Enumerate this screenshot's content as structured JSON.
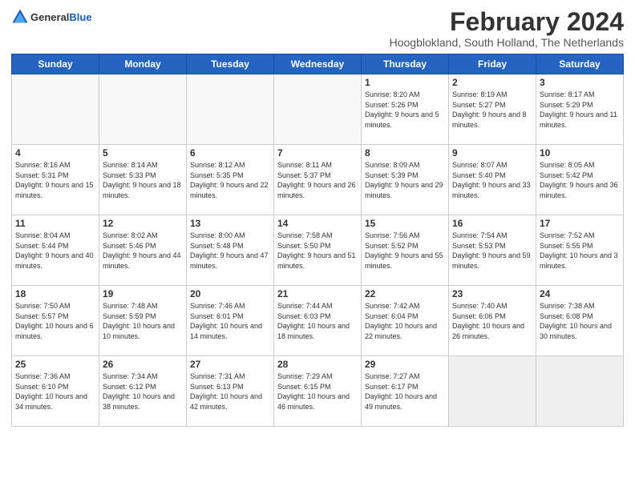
{
  "header": {
    "logo": {
      "general": "General",
      "blue": "Blue"
    },
    "title": "February 2024",
    "subtitle": "Hoogblokland, South Holland, The Netherlands"
  },
  "calendar": {
    "headers": [
      "Sunday",
      "Monday",
      "Tuesday",
      "Wednesday",
      "Thursday",
      "Friday",
      "Saturday"
    ],
    "weeks": [
      [
        {
          "day": "",
          "empty": true
        },
        {
          "day": "",
          "empty": true
        },
        {
          "day": "",
          "empty": true
        },
        {
          "day": "",
          "empty": true
        },
        {
          "day": "1",
          "info": "Sunrise: 8:20 AM\nSunset: 5:26 PM\nDaylight: 9 hours\nand 5 minutes."
        },
        {
          "day": "2",
          "info": "Sunrise: 8:19 AM\nSunset: 5:27 PM\nDaylight: 9 hours\nand 8 minutes."
        },
        {
          "day": "3",
          "info": "Sunrise: 8:17 AM\nSunset: 5:29 PM\nDaylight: 9 hours\nand 11 minutes."
        }
      ],
      [
        {
          "day": "4",
          "info": "Sunrise: 8:16 AM\nSunset: 5:31 PM\nDaylight: 9 hours\nand 15 minutes."
        },
        {
          "day": "5",
          "info": "Sunrise: 8:14 AM\nSunset: 5:33 PM\nDaylight: 9 hours\nand 18 minutes."
        },
        {
          "day": "6",
          "info": "Sunrise: 8:12 AM\nSunset: 5:35 PM\nDaylight: 9 hours\nand 22 minutes."
        },
        {
          "day": "7",
          "info": "Sunrise: 8:11 AM\nSunset: 5:37 PM\nDaylight: 9 hours\nand 26 minutes."
        },
        {
          "day": "8",
          "info": "Sunrise: 8:09 AM\nSunset: 5:39 PM\nDaylight: 9 hours\nand 29 minutes."
        },
        {
          "day": "9",
          "info": "Sunrise: 8:07 AM\nSunset: 5:40 PM\nDaylight: 9 hours\nand 33 minutes."
        },
        {
          "day": "10",
          "info": "Sunrise: 8:05 AM\nSunset: 5:42 PM\nDaylight: 9 hours\nand 36 minutes."
        }
      ],
      [
        {
          "day": "11",
          "info": "Sunrise: 8:04 AM\nSunset: 5:44 PM\nDaylight: 9 hours\nand 40 minutes."
        },
        {
          "day": "12",
          "info": "Sunrise: 8:02 AM\nSunset: 5:46 PM\nDaylight: 9 hours\nand 44 minutes."
        },
        {
          "day": "13",
          "info": "Sunrise: 8:00 AM\nSunset: 5:48 PM\nDaylight: 9 hours\nand 47 minutes."
        },
        {
          "day": "14",
          "info": "Sunrise: 7:58 AM\nSunset: 5:50 PM\nDaylight: 9 hours\nand 51 minutes."
        },
        {
          "day": "15",
          "info": "Sunrise: 7:56 AM\nSunset: 5:52 PM\nDaylight: 9 hours\nand 55 minutes."
        },
        {
          "day": "16",
          "info": "Sunrise: 7:54 AM\nSunset: 5:53 PM\nDaylight: 9 hours\nand 59 minutes."
        },
        {
          "day": "17",
          "info": "Sunrise: 7:52 AM\nSunset: 5:55 PM\nDaylight: 10 hours\nand 3 minutes."
        }
      ],
      [
        {
          "day": "18",
          "info": "Sunrise: 7:50 AM\nSunset: 5:57 PM\nDaylight: 10 hours\nand 6 minutes."
        },
        {
          "day": "19",
          "info": "Sunrise: 7:48 AM\nSunset: 5:59 PM\nDaylight: 10 hours\nand 10 minutes."
        },
        {
          "day": "20",
          "info": "Sunrise: 7:46 AM\nSunset: 6:01 PM\nDaylight: 10 hours\nand 14 minutes."
        },
        {
          "day": "21",
          "info": "Sunrise: 7:44 AM\nSunset: 6:03 PM\nDaylight: 10 hours\nand 18 minutes."
        },
        {
          "day": "22",
          "info": "Sunrise: 7:42 AM\nSunset: 6:04 PM\nDaylight: 10 hours\nand 22 minutes."
        },
        {
          "day": "23",
          "info": "Sunrise: 7:40 AM\nSunset: 6:06 PM\nDaylight: 10 hours\nand 26 minutes."
        },
        {
          "day": "24",
          "info": "Sunrise: 7:38 AM\nSunset: 6:08 PM\nDaylight: 10 hours\nand 30 minutes."
        }
      ],
      [
        {
          "day": "25",
          "info": "Sunrise: 7:36 AM\nSunset: 6:10 PM\nDaylight: 10 hours\nand 34 minutes."
        },
        {
          "day": "26",
          "info": "Sunrise: 7:34 AM\nSunset: 6:12 PM\nDaylight: 10 hours\nand 38 minutes."
        },
        {
          "day": "27",
          "info": "Sunrise: 7:31 AM\nSunset: 6:13 PM\nDaylight: 10 hours\nand 42 minutes."
        },
        {
          "day": "28",
          "info": "Sunrise: 7:29 AM\nSunset: 6:15 PM\nDaylight: 10 hours\nand 46 minutes."
        },
        {
          "day": "29",
          "info": "Sunrise: 7:27 AM\nSunset: 6:17 PM\nDaylight: 10 hours\nand 49 minutes."
        },
        {
          "day": "",
          "empty": true,
          "shaded": true
        },
        {
          "day": "",
          "empty": true,
          "shaded": true
        }
      ]
    ]
  }
}
